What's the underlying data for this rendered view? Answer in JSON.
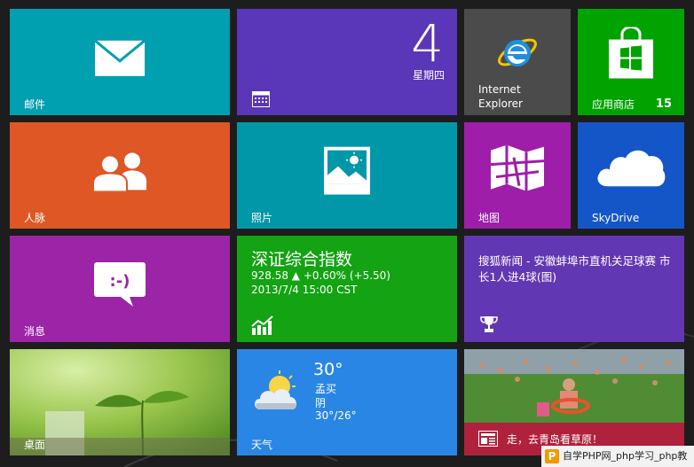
{
  "tiles": {
    "mail": {
      "label": "邮件"
    },
    "calendar": {
      "day": "4",
      "weekday": "星期四"
    },
    "ie": {
      "label_line1": "Internet",
      "label_line2": "Explorer"
    },
    "store": {
      "label": "应用商店",
      "count": "15"
    },
    "people": {
      "label": "人脉"
    },
    "photos": {
      "label": "照片"
    },
    "maps": {
      "label": "地图"
    },
    "skydrive": {
      "label": "SkyDrive"
    },
    "messaging": {
      "label": "消息"
    },
    "finance": {
      "title": "深证综合指数",
      "quote": "928.58 ▲ +0.60% (+5.50)",
      "time": "2013/7/4 15:00 CST"
    },
    "news": {
      "headline": "搜狐新闻 - 安徽蚌埠市直机关足球赛 市长1人进4球(图)"
    },
    "desktop": {
      "label": "桌面"
    },
    "weather": {
      "label": "天气",
      "temp": "30°",
      "city": "孟买",
      "cond": "阴",
      "range": "30°/26°"
    },
    "photo_news": {
      "caption": "走，去青岛看草原！"
    }
  },
  "watermark": {
    "icon": "P",
    "text": "自学PHP网_php学习_php教"
  },
  "colors": {
    "teal": "#00a0b0",
    "purple": "#5a36b8",
    "gray": "#4b4b4b",
    "green": "#00a300",
    "orange": "#de5725",
    "magenta": "#9e1ea9",
    "blue": "#1456c8",
    "news_red": "#b0213b"
  }
}
